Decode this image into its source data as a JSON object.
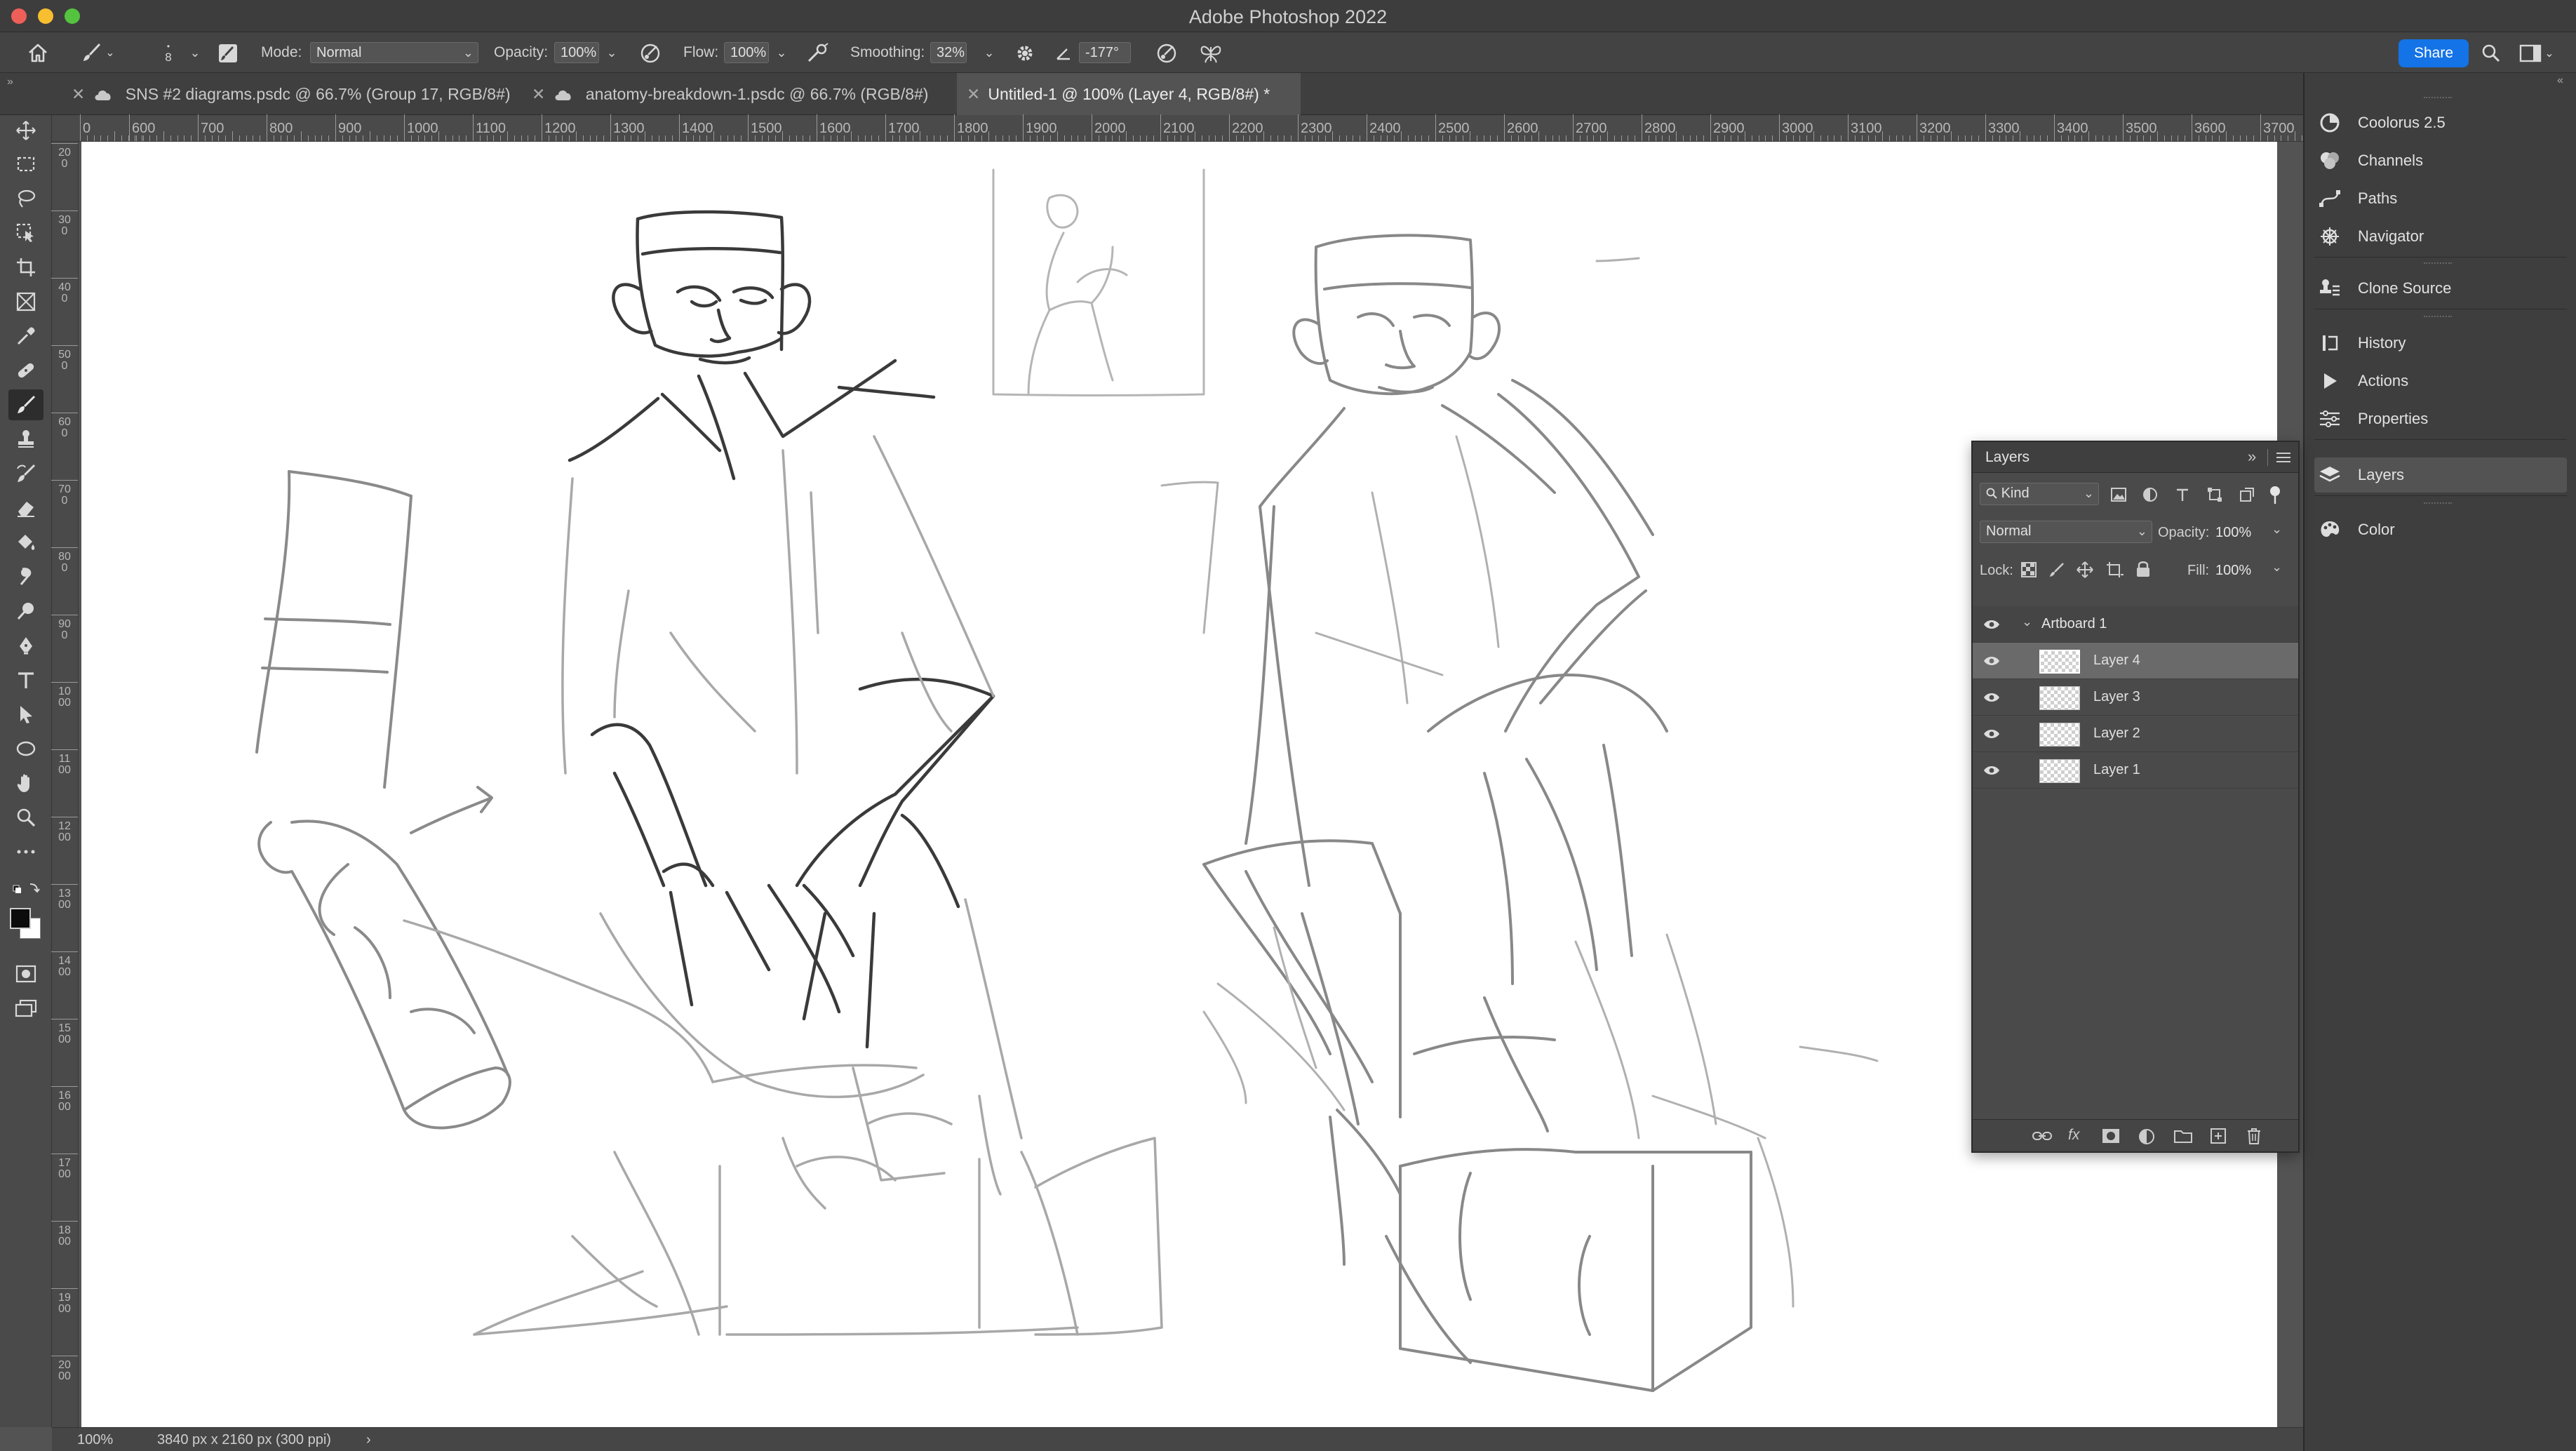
{
  "window": {
    "title": "Adobe Photoshop 2022"
  },
  "options": {
    "brush_size": "8",
    "mode_label": "Mode:",
    "mode_value": "Normal",
    "opacity_label": "Opacity:",
    "opacity_value": "100%",
    "flow_label": "Flow:",
    "flow_value": "100%",
    "smoothing_label": "Smoothing:",
    "smoothing_value": "32%",
    "angle_value": "-177°",
    "share_label": "Share"
  },
  "tabs": [
    {
      "label": "SNS #2 diagrams.psdc @ 66.7% (Group 17, RGB/8#)",
      "cloud": true
    },
    {
      "label": "anatomy-breakdown-1.psdc @ 66.7% (RGB/8#)",
      "cloud": true
    },
    {
      "label": "Untitled-1 @ 100% (Layer 4, RGB/8#) *",
      "cloud": false
    }
  ],
  "ruler": {
    "top": [
      "0",
      "600",
      "700",
      "800",
      "900",
      "1000",
      "1100",
      "1200",
      "1300",
      "1400",
      "1500",
      "1600",
      "1700",
      "1800",
      "1900",
      "2000",
      "2100",
      "2200",
      "2300",
      "2400",
      "2500",
      "2600",
      "2700",
      "2800",
      "2900",
      "3000",
      "3100",
      "3200",
      "3300",
      "3400",
      "3500",
      "3600",
      "3700"
    ],
    "left": [
      "200",
      "300",
      "400",
      "500",
      "600",
      "700",
      "800",
      "900",
      "1000",
      "1100",
      "1200",
      "1300",
      "1400",
      "1500",
      "1600",
      "1700",
      "1800",
      "1900",
      "2000"
    ]
  },
  "status": {
    "zoom": "100%",
    "doc_size": "3840 px x 2160 px (300 ppi)",
    "arrow": "›"
  },
  "dock": {
    "items": [
      {
        "label": "Coolorus 2.5",
        "icon": "coolorus-icon"
      },
      {
        "label": "Channels",
        "icon": "channels-icon"
      },
      {
        "label": "Paths",
        "icon": "paths-icon"
      },
      {
        "label": "Navigator",
        "icon": "navigator-icon"
      },
      {
        "label": "Clone Source",
        "icon": "clone-source-icon"
      },
      {
        "label": "History",
        "icon": "history-icon"
      },
      {
        "label": "Actions",
        "icon": "actions-icon"
      },
      {
        "label": "Properties",
        "icon": "properties-icon"
      },
      {
        "label": "Layers",
        "icon": "layers-icon"
      },
      {
        "label": "Color",
        "icon": "color-icon"
      }
    ]
  },
  "layers": {
    "title": "Layers",
    "filter_value": "Kind",
    "blend_value": "Normal",
    "opacity_label": "Opacity:",
    "opacity_value": "100%",
    "lock_label": "Lock:",
    "fill_label": "Fill:",
    "fill_value": "100%",
    "group": "Artboard 1",
    "items": [
      "Layer 4",
      "Layer 3",
      "Layer 2",
      "Layer 1"
    ],
    "selected": "Layer 4"
  }
}
